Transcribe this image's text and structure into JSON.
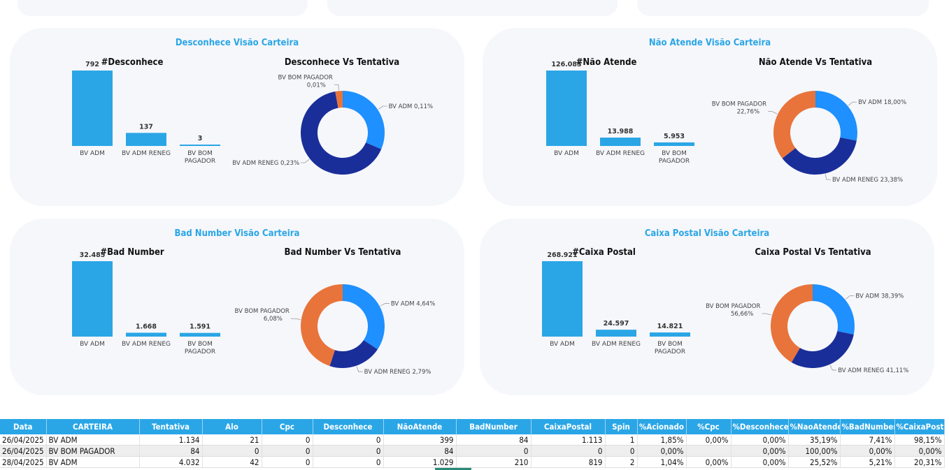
{
  "colors": {
    "accent": "#2aa6e6",
    "bar": "#2aa6e6",
    "bv_adm": "#1e90ff",
    "bv_adm_reneg": "#1a2e9a",
    "bv_bom_pagador": "#e8743b"
  },
  "panels": [
    {
      "title": "Desconhece Visão Carteira",
      "bar_title": "#Desconhece",
      "donut_title": "Desconhece Vs Tentativa",
      "chart_data": [
        {
          "type": "bar",
          "categories": [
            "BV ADM",
            "BV ADM RENEG",
            "BV BOM PAGADOR"
          ],
          "values": [
            792,
            137,
            3
          ],
          "value_labels": [
            "792",
            "137",
            "3"
          ]
        },
        {
          "type": "pie",
          "labels": [
            "BV ADM",
            "BV ADM RENEG",
            "BV BOM PAGADOR"
          ],
          "values": [
            0.11,
            0.23,
            0.01
          ],
          "callouts": [
            "BV ADM 0,11%",
            "BV ADM RENEG 0,23%",
            "BV BOM PAGADOR 0,01%"
          ]
        }
      ]
    },
    {
      "title": "Não Atende Visão Carteira",
      "bar_title": "#Não Atende",
      "donut_title": "Não Atende Vs Tentativa",
      "chart_data": [
        {
          "type": "bar",
          "categories": [
            "BV ADM",
            "BV ADM RENEG",
            "BV BOM PAGADOR"
          ],
          "values": [
            126083,
            13988,
            5953
          ],
          "value_labels": [
            "126.083",
            "13.988",
            "5.953"
          ]
        },
        {
          "type": "pie",
          "labels": [
            "BV ADM",
            "BV ADM RENEG",
            "BV BOM PAGADOR"
          ],
          "values": [
            18.0,
            23.38,
            22.76
          ],
          "callouts": [
            "BV ADM 18,00%",
            "BV ADM RENEG 23,38%",
            "BV BOM PAGADOR 22,76%"
          ]
        }
      ]
    },
    {
      "title": "Bad Number Visão Carteira",
      "bar_title": "#Bad Number",
      "donut_title": "Bad Number Vs Tentativa",
      "chart_data": [
        {
          "type": "bar",
          "categories": [
            "BV ADM",
            "BV ADM RENEG",
            "BV BOM PAGADOR"
          ],
          "values": [
            32485,
            1668,
            1591
          ],
          "value_labels": [
            "32.485",
            "1.668",
            "1.591"
          ]
        },
        {
          "type": "pie",
          "labels": [
            "BV ADM",
            "BV ADM RENEG",
            "BV BOM PAGADOR"
          ],
          "values": [
            4.64,
            2.79,
            6.08
          ],
          "callouts": [
            "BV ADM 4,64%",
            "BV ADM RENEG 2,79%",
            "BV BOM PAGADOR 6,08%"
          ]
        }
      ]
    },
    {
      "title": "Caixa Postal Visão Carteira",
      "bar_title": "#Caixa Postal",
      "donut_title": "Caixa Postal Vs Tentativa",
      "chart_data": [
        {
          "type": "bar",
          "categories": [
            "BV ADM",
            "BV ADM RENEG",
            "BV BOM PAGADOR"
          ],
          "values": [
            268921,
            24597,
            14821
          ],
          "value_labels": [
            "268.921",
            "24.597",
            "14.821"
          ]
        },
        {
          "type": "pie",
          "labels": [
            "BV ADM",
            "BV ADM RENEG",
            "BV BOM PAGADOR"
          ],
          "values": [
            38.39,
            41.11,
            56.66
          ],
          "callouts": [
            "BV ADM 38,39%",
            "BV ADM RENEG 41,11%",
            "BV BOM PAGADOR 56,66%"
          ]
        }
      ]
    }
  ],
  "table": {
    "columns": [
      "Data",
      "CARTEIRA",
      "Tentativa",
      "Alo",
      "Cpc",
      "Desconhece",
      "NãoAtende",
      "BadNumber",
      "CaixaPostal",
      "Spin",
      "%Acionado",
      "%Cpc",
      "%Desconhece",
      "%NaoAtende",
      "%BadNumber",
      "%CaixaPostal"
    ],
    "rows": [
      [
        "26/04/2025",
        "BV ADM",
        "1.134",
        "21",
        "0",
        "0",
        "399",
        "84",
        "1.113",
        "1",
        "1,85%",
        "0,00%",
        "0,00%",
        "35,19%",
        "7,41%",
        "98,15%"
      ],
      [
        "26/04/2025",
        "BV BOM PAGADOR",
        "84",
        "0",
        "0",
        "0",
        "84",
        "0",
        "0",
        "0",
        "0,00%",
        "",
        "0,00%",
        "100,00%",
        "0,00%",
        "0,00%"
      ],
      [
        "28/04/2025",
        "BV ADM",
        "4.032",
        "42",
        "0",
        "0",
        "1.029",
        "210",
        "819",
        "2",
        "1,04%",
        "0,00%",
        "0,00%",
        "25,52%",
        "5,21%",
        "20,31%"
      ]
    ]
  }
}
